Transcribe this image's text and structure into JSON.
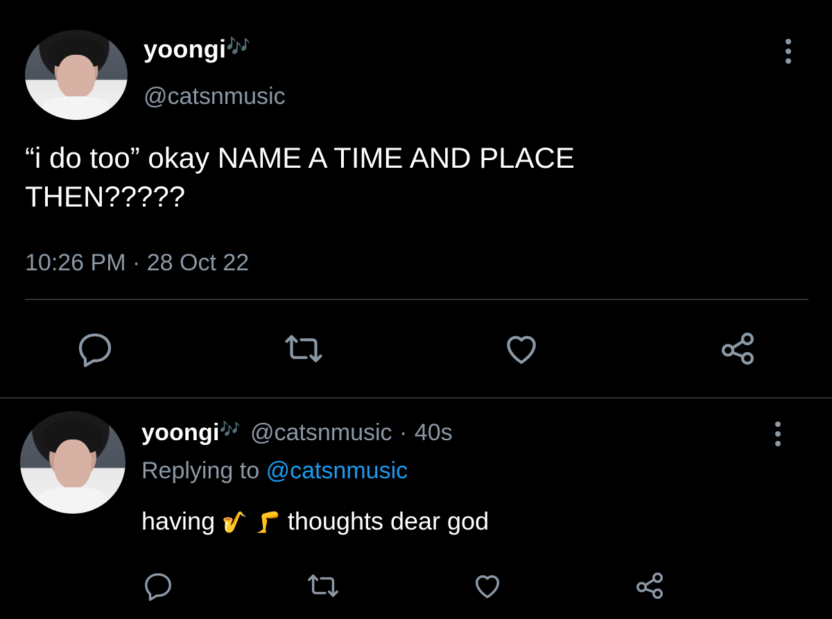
{
  "main_tweet": {
    "display_name": "yoongi",
    "name_emoji": "🎶",
    "handle": "@catsnmusic",
    "text": "“i do too” okay NAME A TIME AND PLACE THEN?????",
    "timestamp": "10:26 PM · 28 Oct 22"
  },
  "reply": {
    "display_name": "yoongi",
    "name_emoji": "🎶",
    "handle": "@catsnmusic",
    "separator": "·",
    "age": "40s",
    "replying_prefix": "Replying to",
    "replying_handle": "@catsnmusic",
    "text_before": "having",
    "emoji_1": "🎷",
    "emoji_2": "🦵",
    "text_after": "thoughts dear god"
  },
  "icons": {
    "reply": "reply-icon",
    "retweet": "retweet-icon",
    "like": "heart-icon",
    "share": "share-icon",
    "more": "more-vertical-icon"
  },
  "colors": {
    "background": "#000000",
    "text": "#ffffff",
    "secondary": "#8b98a5",
    "link": "#1d9bf0",
    "divider": "#2f3336"
  }
}
